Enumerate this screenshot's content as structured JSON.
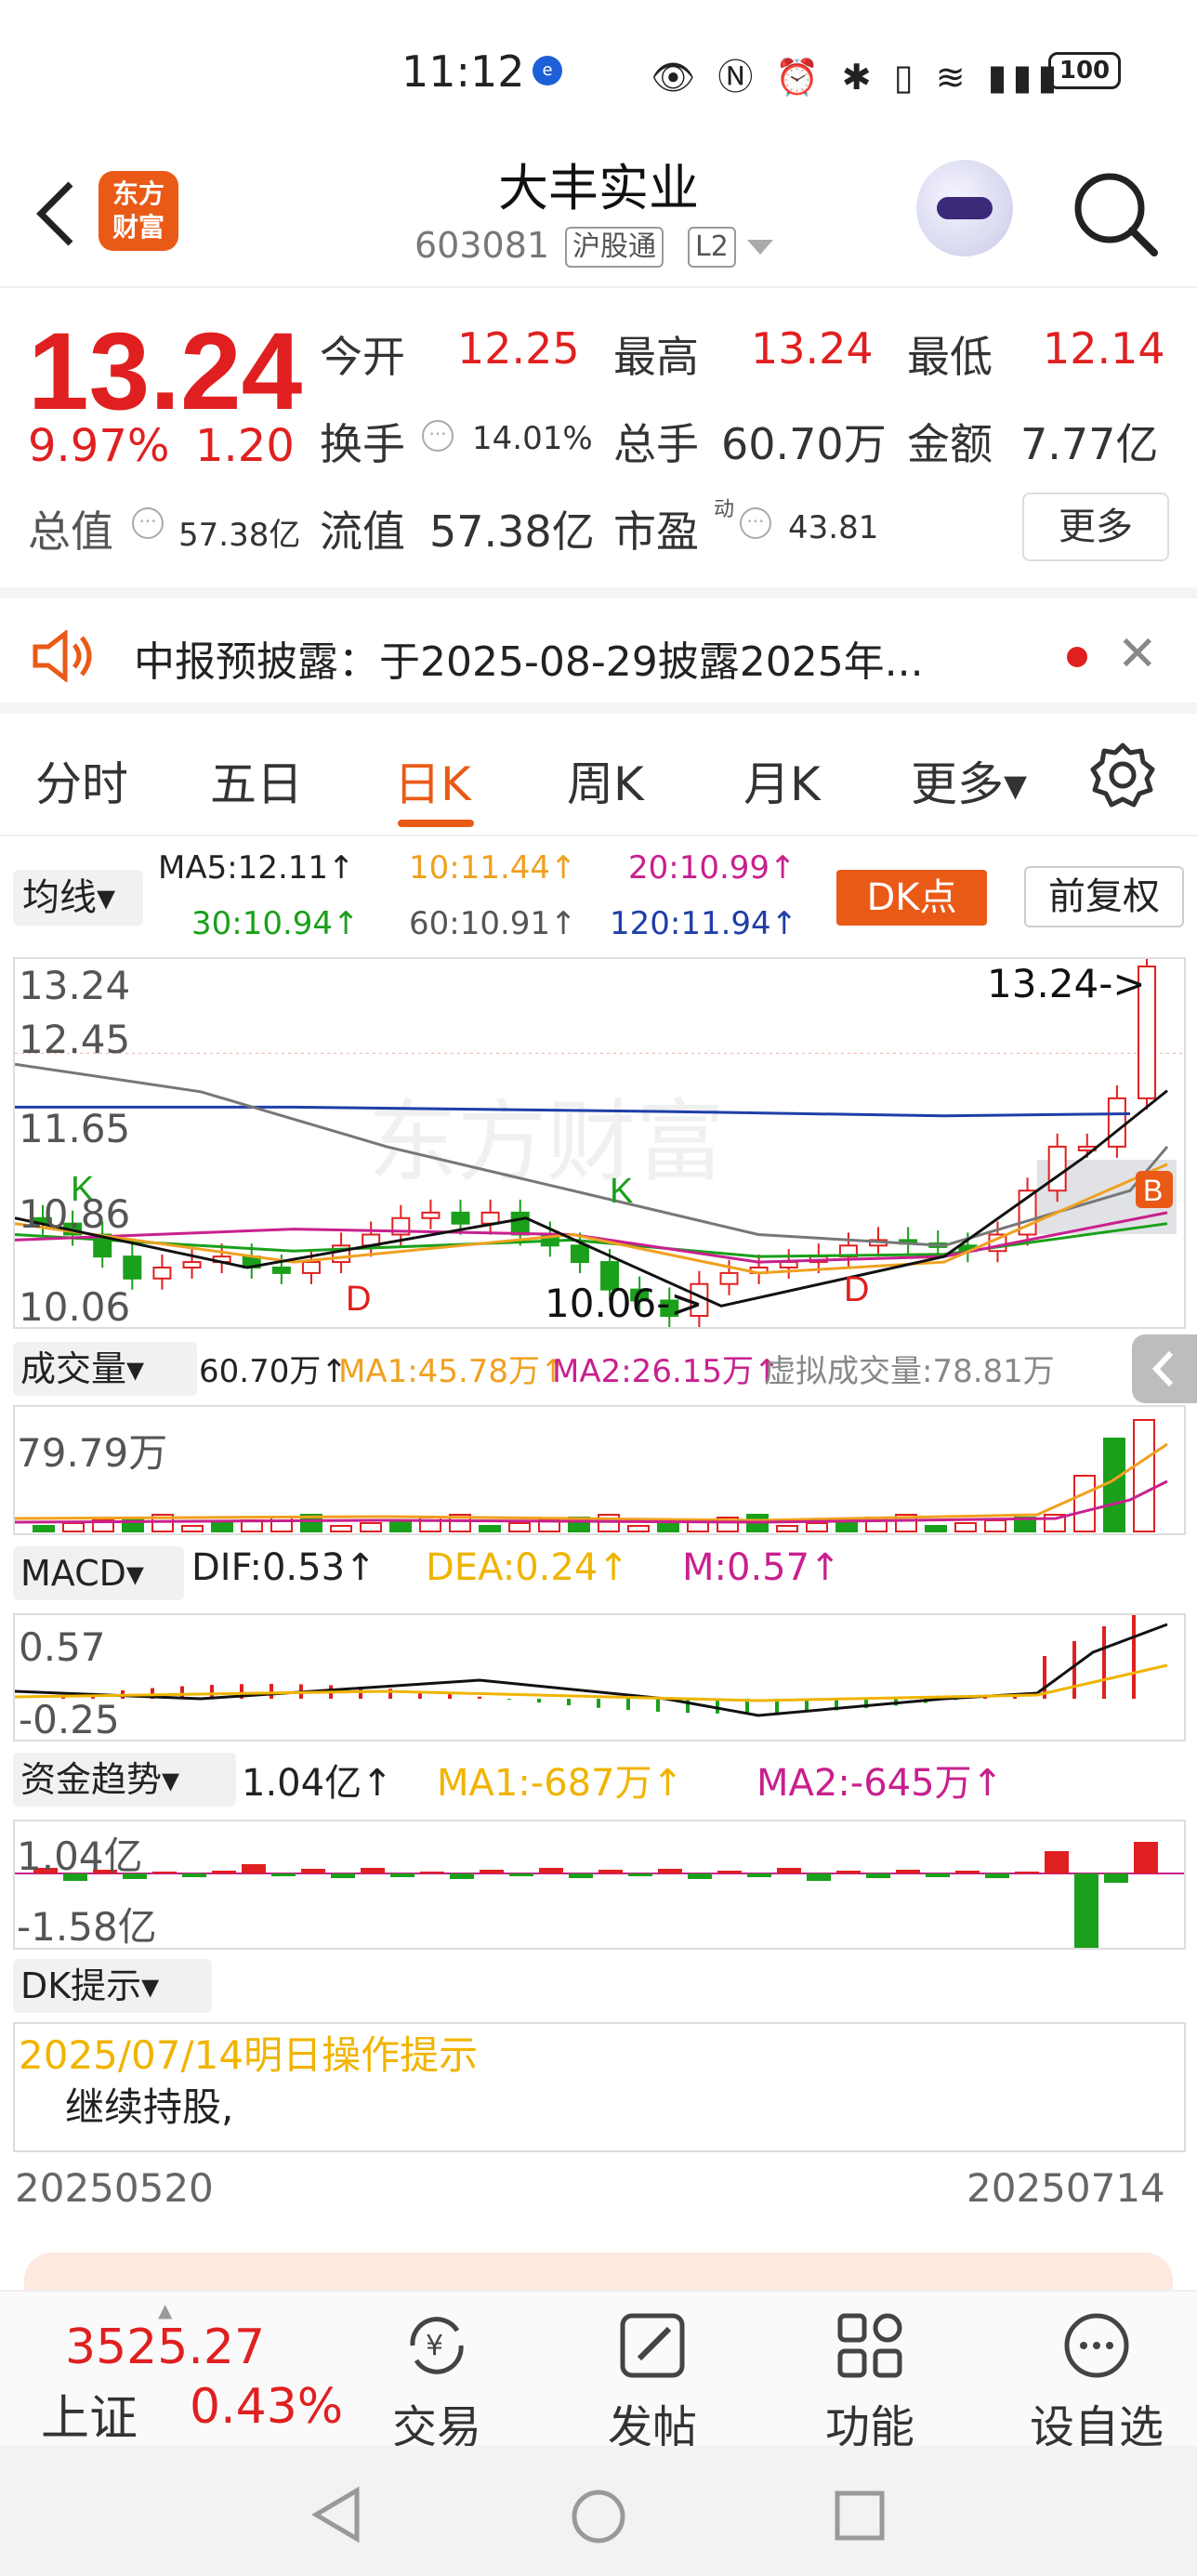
{
  "status": {
    "time": "11:12",
    "battery": "100"
  },
  "header": {
    "title": "大丰实业",
    "code": "603081",
    "tag1": "沪股通",
    "tag2": "L2",
    "logo_line1": "东方",
    "logo_line2": "财富"
  },
  "quote": {
    "price": "13.24",
    "pct": "9.97%",
    "chg": "1.20",
    "open_label": "今开",
    "open": "12.25",
    "high_label": "最高",
    "high": "13.24",
    "low_label": "最低",
    "low": "12.14",
    "turnover_label": "换手",
    "turnover": "14.01%",
    "volume_label": "总手",
    "volume": "60.70万",
    "amount_label": "金额",
    "amount": "7.77亿",
    "mcap_label": "总值",
    "mcap": "57.38亿",
    "float_label": "流值",
    "float": "57.38亿",
    "pe_label": "市盈",
    "pe_sup": "动",
    "pe": "43.81",
    "more": "更多"
  },
  "notice": {
    "text": "中报预披露：于2025-08-29披露2025年..."
  },
  "tabs": [
    "分时",
    "五日",
    "日K",
    "周K",
    "月K",
    "更多▾"
  ],
  "ma": {
    "select": "均线▾",
    "ma5": "MA5:12.11↑",
    "ma10": "10:11.44↑",
    "ma20": "20:10.99↑",
    "ma30": "30:10.94↑",
    "ma60": "60:10.91↑",
    "ma120": "120:11.94↑",
    "dk": "DK点",
    "fq": "前复权"
  },
  "kline": {
    "y_labels": [
      "13.24",
      "12.45",
      "11.65",
      "10.86",
      "10.06"
    ],
    "hi_tag": "13.24->",
    "lo_tag": "10.06->",
    "marks": [
      "K",
      "K",
      "D",
      "D",
      "B"
    ],
    "watermark": "东方财富"
  },
  "volume": {
    "select": "成交量▾",
    "value": "60.70万↑",
    "ma1": "MA1:45.78万↑",
    "ma2": "MA2:26.15万↑",
    "virtual": "虚拟成交量:78.81万",
    "max": "79.79万"
  },
  "macd": {
    "select": "MACD▾",
    "dif": "DIF:0.53↑",
    "dea": "DEA:0.24↑",
    "m": "M:0.57↑",
    "top": "0.57",
    "bottom": "-0.25"
  },
  "fund": {
    "select": "资金趋势▾",
    "value": "1.04亿↑",
    "ma1": "MA1:-687万↑",
    "ma2": "MA2:-645万↑",
    "top": "1.04亿",
    "bottom": "-1.58亿"
  },
  "dk": {
    "select": "DK提示▾",
    "date_line": "2025/07/14明日操作提示",
    "advice": "继续持股,"
  },
  "dates": {
    "start": "20250520",
    "end": "20250714"
  },
  "nav": {
    "index_value": "3525.27",
    "index_name": "上证",
    "index_pct": "0.43%",
    "items": [
      "交易",
      "发帖",
      "功能",
      "设自选"
    ]
  },
  "colors": {
    "up": "#e02020",
    "down": "#1aa01a",
    "accent": "#ea5a17"
  },
  "chart_data": {
    "type": "candlestick",
    "x_range": [
      "20250520",
      "20250714"
    ],
    "ylim": [
      10.06,
      13.24
    ],
    "last": {
      "close": 13.24,
      "open": 12.25,
      "high": 13.24,
      "low": 12.14
    },
    "ma": {
      "MA5": 12.11,
      "MA10": 11.44,
      "MA20": 10.99,
      "MA30": 10.94,
      "MA60": 10.91,
      "MA120": 11.94
    }
  }
}
